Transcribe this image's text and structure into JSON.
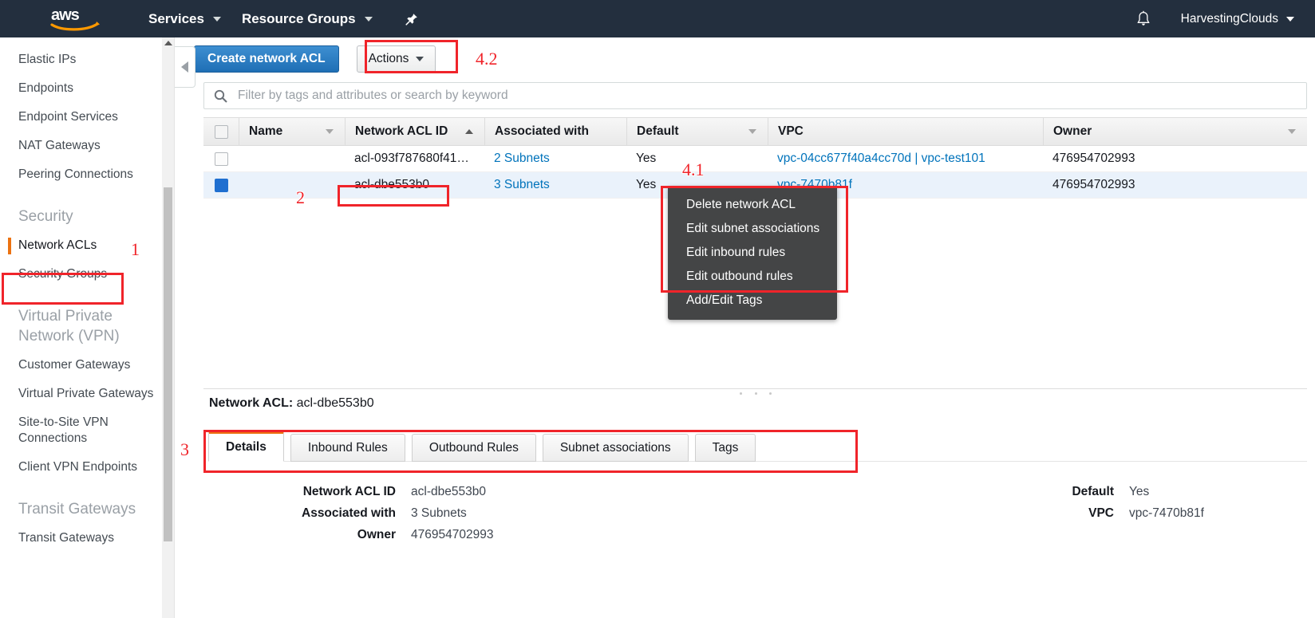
{
  "topnav": {
    "logo_alt": "aws",
    "services_label": "Services",
    "resource_groups_label": "Resource Groups",
    "pin_icon": "pin-icon",
    "bell_icon": "bell-icon",
    "account_label": "HarvestingClouds"
  },
  "sidebar": {
    "items": [
      {
        "label": "Elastic IPs",
        "type": "link",
        "active": false
      },
      {
        "label": "Endpoints",
        "type": "link",
        "active": false
      },
      {
        "label": "Endpoint Services",
        "type": "link",
        "active": false
      },
      {
        "label": "NAT Gateways",
        "type": "link",
        "active": false
      },
      {
        "label": "Peering Connections",
        "type": "link",
        "active": false
      },
      {
        "label": "Security",
        "type": "heading"
      },
      {
        "label": "Network ACLs",
        "type": "link",
        "active": true
      },
      {
        "label": "Security Groups",
        "type": "link",
        "active": false
      },
      {
        "label": "Virtual Private Network (VPN)",
        "type": "heading"
      },
      {
        "label": "Customer Gateways",
        "type": "link",
        "active": false
      },
      {
        "label": "Virtual Private Gateways",
        "type": "link",
        "active": false
      },
      {
        "label": "Site-to-Site VPN Connections",
        "type": "link",
        "active": false
      },
      {
        "label": "Client VPN Endpoints",
        "type": "link",
        "active": false
      },
      {
        "label": "Transit Gateways",
        "type": "heading"
      },
      {
        "label": "Transit Gateways",
        "type": "link",
        "active": false
      }
    ]
  },
  "toolbar": {
    "create_label": "Create network ACL",
    "actions_label": "Actions"
  },
  "search": {
    "placeholder": "Filter by tags and attributes or search by keyword",
    "value": "",
    "icon": "search-icon"
  },
  "table": {
    "columns": [
      {
        "label": "Name",
        "sort": "none-desc"
      },
      {
        "label": "Network ACL ID",
        "sort": "asc"
      },
      {
        "label": "Associated with",
        "sort": ""
      },
      {
        "label": "Default",
        "sort": "none-desc"
      },
      {
        "label": "VPC",
        "sort": ""
      },
      {
        "label": "Owner",
        "sort": "none-desc"
      }
    ],
    "rows": [
      {
        "selected": false,
        "name": "",
        "acl_id": "acl-093f787680f41…",
        "associated_with": "2 Subnets",
        "default": "Yes",
        "vpc": "vpc-04cc677f40a4cc70d | vpc-test101",
        "owner": "476954702993"
      },
      {
        "selected": true,
        "name": "",
        "acl_id": "acl-dbe553b0",
        "associated_with": "3 Subnets",
        "default": "Yes",
        "vpc": "vpc-7470b81f",
        "owner": "476954702993"
      }
    ]
  },
  "actions_menu": {
    "items": [
      "Delete network ACL",
      "Edit subnet associations",
      "Edit inbound rules",
      "Edit outbound rules",
      "Add/Edit Tags"
    ]
  },
  "detail": {
    "title_label": "Network ACL:",
    "title_value": "acl-dbe553b0",
    "tabs": [
      {
        "label": "Details",
        "active": true
      },
      {
        "label": "Inbound Rules",
        "active": false
      },
      {
        "label": "Outbound Rules",
        "active": false
      },
      {
        "label": "Subnet associations",
        "active": false
      },
      {
        "label": "Tags",
        "active": false
      }
    ],
    "left_fields": [
      {
        "label": "Network ACL ID",
        "value": "acl-dbe553b0",
        "link": false
      },
      {
        "label": "Associated with",
        "value": "3 Subnets",
        "link": true
      },
      {
        "label": "Owner",
        "value": "476954702993",
        "link": false
      }
    ],
    "right_fields": [
      {
        "label": "Default",
        "value": "Yes",
        "link": false
      },
      {
        "label": "VPC",
        "value": "vpc-7470b81f",
        "link": true
      }
    ]
  },
  "annotations": [
    {
      "id": "1",
      "label": "1"
    },
    {
      "id": "2",
      "label": "2"
    },
    {
      "id": "3",
      "label": "3"
    },
    {
      "id": "4_1",
      "label": "4.1"
    },
    {
      "id": "4_2",
      "label": "4.2"
    }
  ],
  "colors": {
    "nav_bg": "#232f3e",
    "accent_orange": "#ec7211",
    "link_blue": "#0073bb",
    "primary_blue": "#2a7ac1",
    "annotation_red": "#f0242a",
    "menu_dark": "#444546"
  }
}
